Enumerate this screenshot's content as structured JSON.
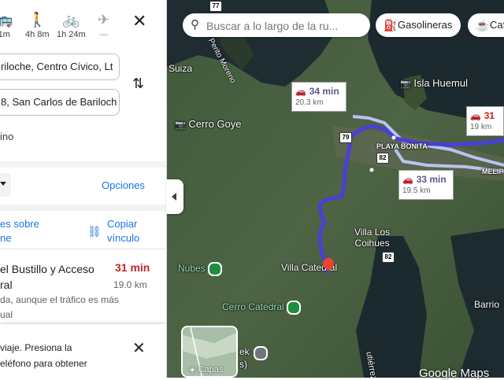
{
  "modes": [
    {
      "icon": "bus-icon",
      "glyph": "🚌",
      "label": "1m"
    },
    {
      "icon": "walk-icon",
      "glyph": "🚶",
      "label": "4h 8m"
    },
    {
      "icon": "bike-icon",
      "glyph": "🚲",
      "label": "1h 24m"
    },
    {
      "icon": "flight-icon",
      "glyph": "✈",
      "label": "—"
    }
  ],
  "origin": "riloche, Centro Cívico, Lt",
  "destination": "8, San Carlos de Bariloch",
  "add_destination": "ino",
  "options_label": "Opciones",
  "send_label": "es sobre ne",
  "send_line1": "es sobre",
  "send_line2": "ne",
  "copy_line1": "Copiar",
  "copy_line2": "vínculo",
  "route": {
    "title_line1": "el Bustillo y Acceso",
    "title_line2": "ral",
    "time": "31 min",
    "distance": "19.0 km",
    "desc_line1": "da, aunque el tráfico es más",
    "desc_line2": "ual"
  },
  "notice": {
    "line1": "viaje. Presiona la",
    "line2": "eléfono para obtener"
  },
  "search": {
    "placeholder": "Buscar a lo largo de la ru..."
  },
  "chips": [
    {
      "icon": "gas-icon",
      "glyph": "⛽",
      "label": "Gasolineras"
    },
    {
      "icon": "coffee-icon",
      "glyph": "☕",
      "label": "Caf"
    }
  ],
  "places": {
    "suiza": "Suiza",
    "perito": "Lago Perito Moreno",
    "isla": "Isla Huemul",
    "goye": "Cerro Goye",
    "playa": "PLAYA BONITA",
    "melip": "MELIP",
    "villa_los_1": "Villa Los",
    "villa_los_2": "Coihues",
    "nubes": "Nubes",
    "villa_catedral": "Villa Catedral",
    "cerro_catedral": "Cerro Catedral",
    "barrio": "Barrio",
    "re": "R",
    "ek": "ek",
    "s": "s)",
    "gutierrez": "utiérrez"
  },
  "callouts": [
    {
      "time": "34 min",
      "dist": "20.3 km"
    },
    {
      "time": "33 min",
      "dist": "19.5 km"
    },
    {
      "time": "31",
      "dist": "19 km"
    }
  ],
  "shields": [
    "77",
    "79",
    "82",
    "82"
  ],
  "layers_label": "Capas",
  "google_maps": "Google Maps",
  "colors": {
    "route_main": "#4a3fd6",
    "route_alt": "#b8c3f0",
    "accent": "#1a73e8",
    "time_red": "#c5221f"
  }
}
